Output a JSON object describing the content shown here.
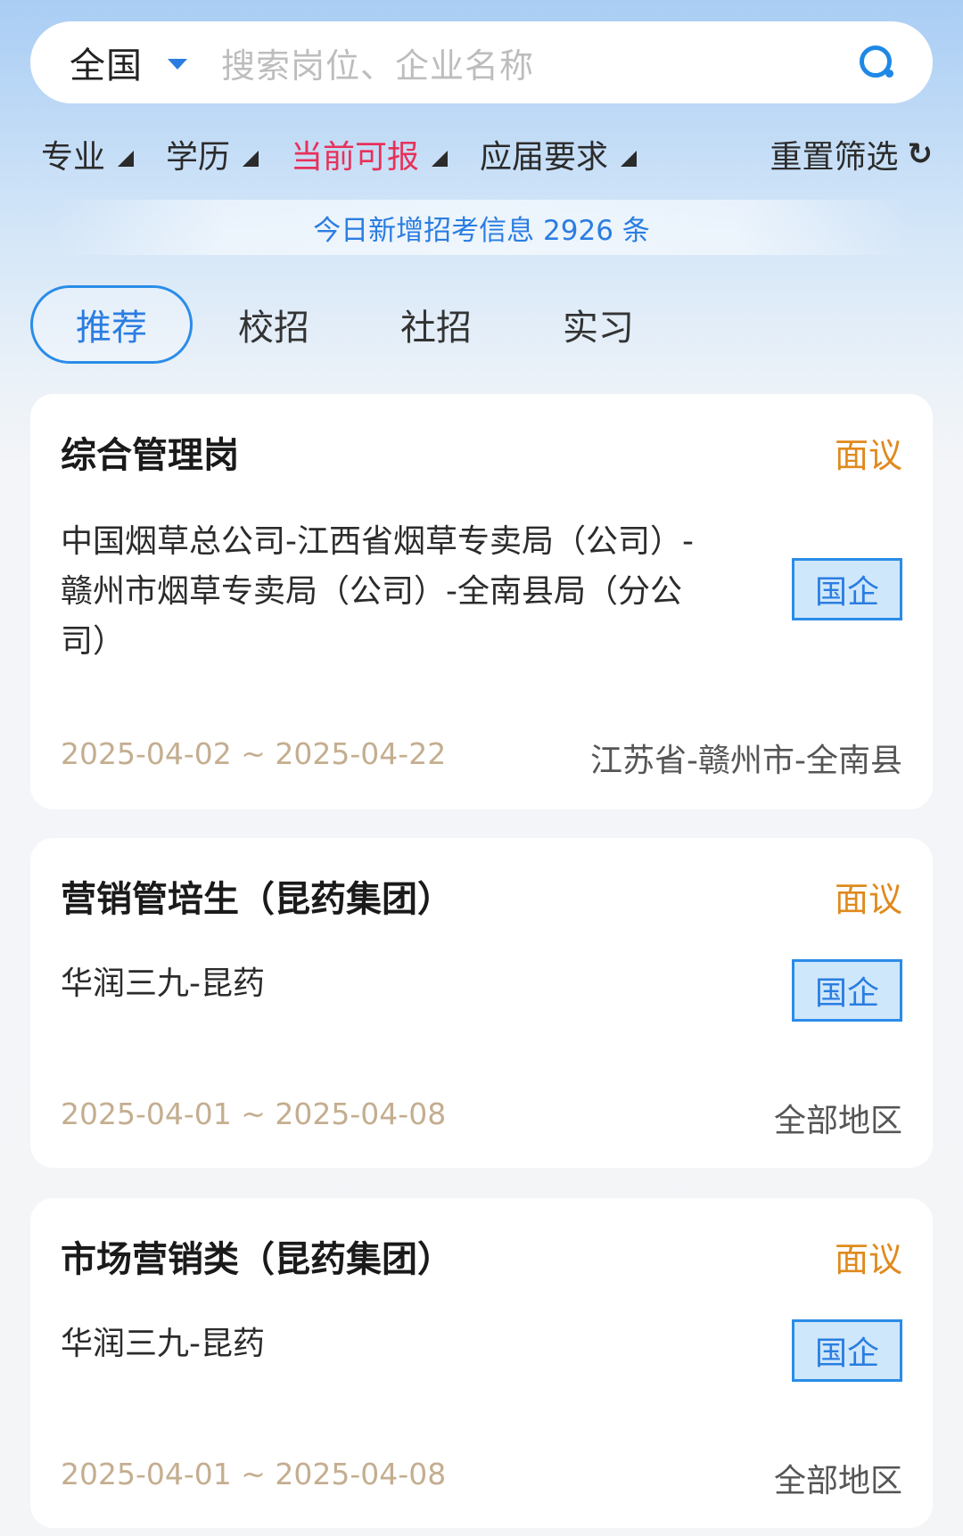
{
  "search": {
    "region": "全国",
    "placeholder": "搜索岗位、企业名称",
    "search_icon": "search-icon"
  },
  "filters": {
    "items": [
      {
        "label": "专业",
        "active": false
      },
      {
        "label": "学历",
        "active": false
      },
      {
        "label": "当前可报",
        "active": true
      },
      {
        "label": "应届要求",
        "active": false
      }
    ],
    "reset_label": "重置筛选",
    "reset_icon": "refresh-icon"
  },
  "banner": {
    "text": "今日新增招考信息 2926 条"
  },
  "tabs": [
    {
      "label": "推荐",
      "active": true
    },
    {
      "label": "校招",
      "active": false
    },
    {
      "label": "社招",
      "active": false
    },
    {
      "label": "实习",
      "active": false
    }
  ],
  "jobs": [
    {
      "title": "综合管理岗",
      "salary": "面议",
      "company": "中国烟草总公司-江西省烟草专卖局（公司）-赣州市烟草专卖局（公司）-全南县局（分公司）",
      "tag": "国企",
      "dates": "2025-04-02 ~ 2025-04-22",
      "location": "江苏省-赣州市-全南县"
    },
    {
      "title": "营销管培生（昆药集团）",
      "salary": "面议",
      "company": "华润三九-昆药",
      "tag": "国企",
      "dates": "2025-04-01 ~ 2025-04-08",
      "location": "全部地区"
    },
    {
      "title": "市场营销类（昆药集团）",
      "salary": "面议",
      "company": "华润三九-昆药",
      "tag": "国企",
      "dates": "2025-04-01 ~ 2025-04-08",
      "location": "全部地区"
    }
  ],
  "colors": {
    "accent_blue": "#2a7de1",
    "active_filter": "#e8315a",
    "salary": "#e08a1e",
    "dates": "#c4ae90"
  }
}
